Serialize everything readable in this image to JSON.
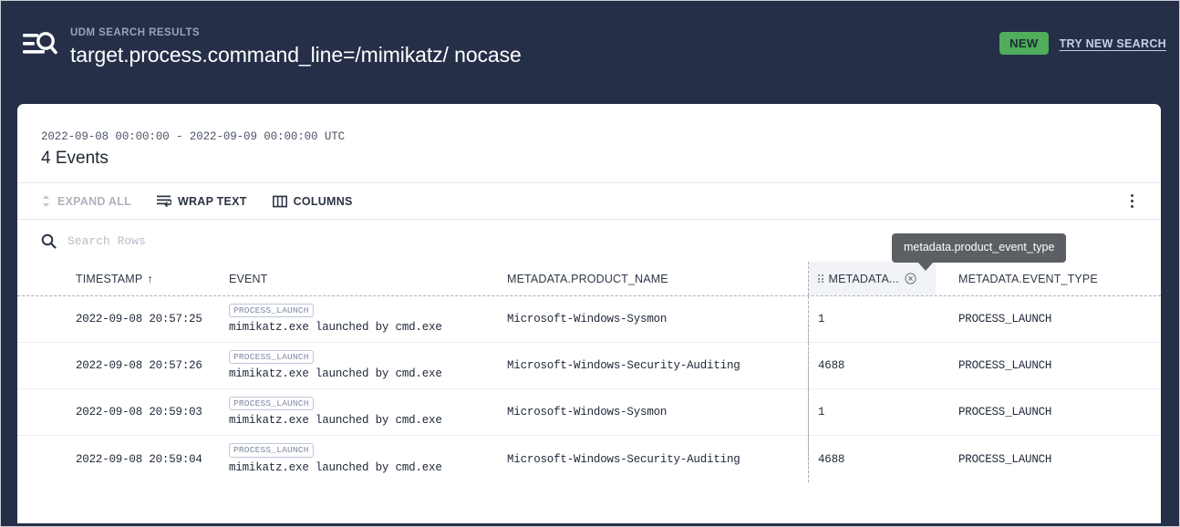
{
  "header": {
    "icon": "search-results-icon",
    "kicker": "UDM SEARCH RESULTS",
    "query": "target.process.command_line=/mimikatz/ nocase",
    "new_badge": "NEW",
    "try_new_search": "TRY NEW SEARCH",
    "background_color": "#252f48",
    "badge_color": "#4fad5b",
    "link_color": "#c3d0e8"
  },
  "results": {
    "date_range": "2022-09-08 00:00:00 - 2022-09-09 00:00:00 UTC",
    "count_label": "4 Events"
  },
  "toolbar": {
    "expand_all": "EXPAND ALL",
    "expand_all_disabled": true,
    "wrap_text": "WRAP TEXT",
    "columns": "COLUMNS",
    "overflow_menu": "more-options"
  },
  "search": {
    "placeholder": "Search Rows",
    "value": ""
  },
  "tooltip": {
    "text": "metadata.product_event_type"
  },
  "table": {
    "columns": [
      {
        "label": "TIMESTAMP",
        "sort": "↑",
        "key": "timestamp"
      },
      {
        "label": "EVENT",
        "key": "event"
      },
      {
        "label": "METADATA.PRODUCT_NAME",
        "key": "product_name"
      },
      {
        "label": "METADATA...",
        "key": "product_event_type",
        "highlighted": true,
        "removable": true
      },
      {
        "label": "METADATA.EVENT_TYPE",
        "key": "event_type"
      }
    ],
    "rows": [
      {
        "timestamp": "2022-09-08 20:57:25",
        "event_chip": "PROCESS_LAUNCH",
        "event_text": "mimikatz.exe launched by cmd.exe",
        "product_name": "Microsoft-Windows-Sysmon",
        "product_event_type": "1",
        "event_type": "PROCESS_LAUNCH"
      },
      {
        "timestamp": "2022-09-08 20:57:26",
        "event_chip": "PROCESS_LAUNCH",
        "event_text": "mimikatz.exe launched by cmd.exe",
        "product_name": "Microsoft-Windows-Security-Auditing",
        "product_event_type": "4688",
        "event_type": "PROCESS_LAUNCH"
      },
      {
        "timestamp": "2022-09-08 20:59:03",
        "event_chip": "PROCESS_LAUNCH",
        "event_text": "mimikatz.exe launched by cmd.exe",
        "product_name": "Microsoft-Windows-Sysmon",
        "product_event_type": "1",
        "event_type": "PROCESS_LAUNCH"
      },
      {
        "timestamp": "2022-09-08 20:59:04",
        "event_chip": "PROCESS_LAUNCH",
        "event_text": "mimikatz.exe launched by cmd.exe",
        "product_name": "Microsoft-Windows-Security-Auditing",
        "product_event_type": "4688",
        "event_type": "PROCESS_LAUNCH"
      }
    ]
  }
}
